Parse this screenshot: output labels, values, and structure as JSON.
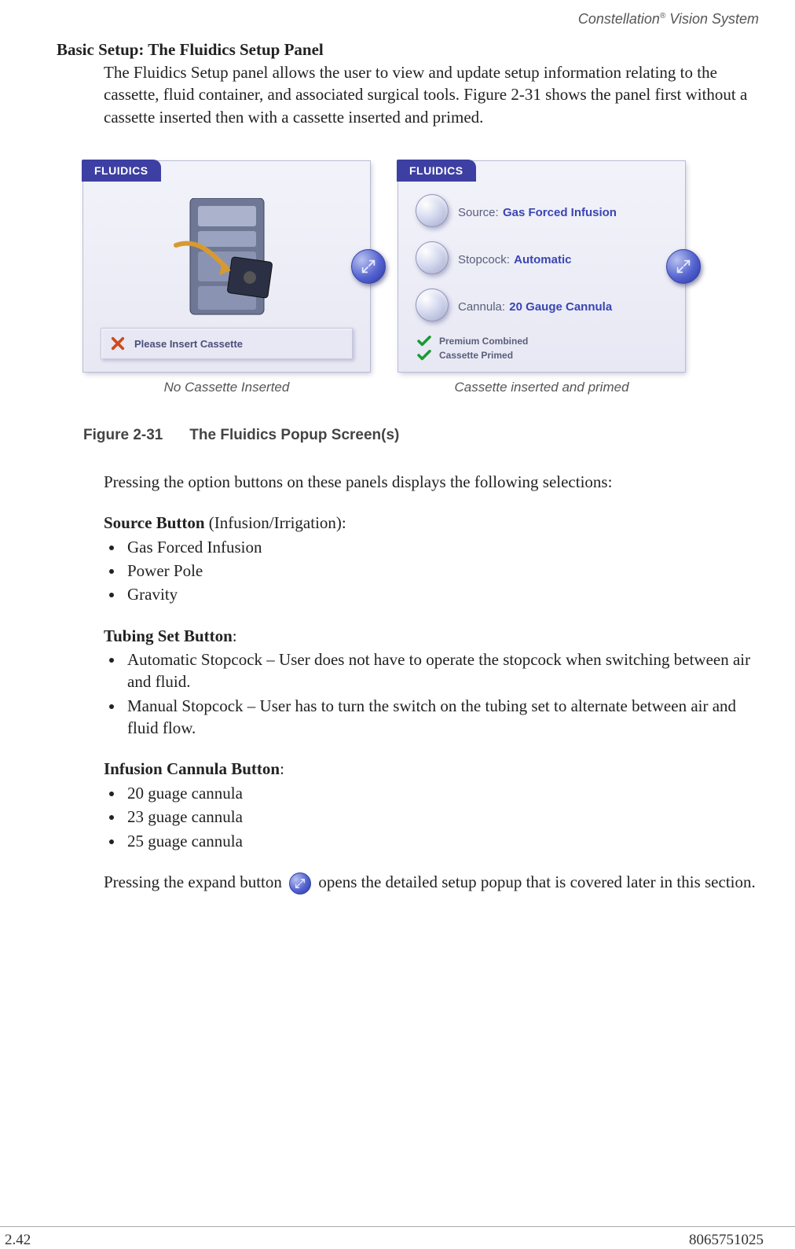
{
  "header": {
    "product": "Constellation",
    "reg": "®",
    "tail": " Vision System"
  },
  "section_heading": "Basic Setup: The Fluidics Setup Panel",
  "intro": "The Fluidics Setup panel allows the user to view and update setup information relating to the cassette, fluid container, and associated surgical tools. Figure 2-31 shows the panel first without a cassette inserted then with a cassette inserted and primed.",
  "panel_tab": "FLUIDICS",
  "left_panel": {
    "message": "Please Insert Cassette"
  },
  "right_panel": {
    "source_label": "Source:",
    "source_value": "Gas Forced Infusion",
    "stopcock_label": "Stopcock:",
    "stopcock_value": "Automatic",
    "cannula_label": "Cannula:",
    "cannula_value": "20 Gauge Cannula",
    "status1": "Premium Combined",
    "status2": "Cassette Primed"
  },
  "caption_left": "No Cassette Inserted",
  "caption_right": "Cassette inserted and primed",
  "figure_label": "Figure 2-31",
  "figure_title": "The Fluidics Popup Screen(s)",
  "lead_sentence": "Pressing the option buttons on these panels displays the following selections:",
  "source_head": "Source Button",
  "source_head_tail": " (Infusion/Irrigation):",
  "source_items": [
    "Gas Forced Infusion",
    "Power Pole",
    "Gravity"
  ],
  "tubing_head": "Tubing Set Button",
  "tubing_items": [
    "Automatic Stopcock – User does not have to operate the stopcock when switching between air and fluid.",
    "Manual Stopcock – User has to turn the switch on the tubing set to alternate between air and fluid flow."
  ],
  "cannula_head": "Infusion Cannula Button",
  "cannula_items": [
    "20 guage cannula",
    "23 guage cannula",
    "25 guage cannula"
  ],
  "expand_sentence_a": "Pressing the expand button ",
  "expand_sentence_b": " opens the detailed setup popup that is covered later in this section.",
  "footer": {
    "left": "2.42",
    "right": "8065751025"
  }
}
